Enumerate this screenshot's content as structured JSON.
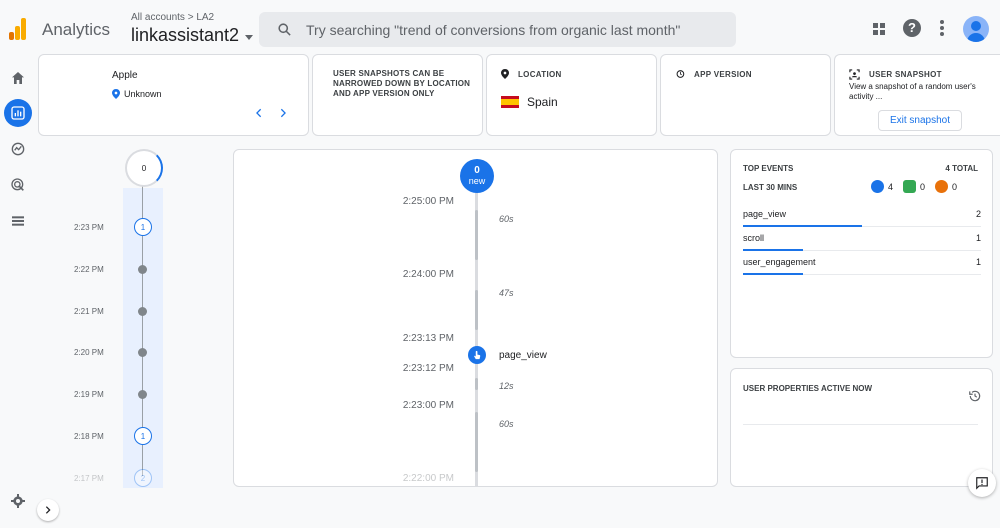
{
  "header": {
    "app_name": "Analytics",
    "account_breadcrumb": "All accounts > LA2",
    "property_name": "linkassistant2",
    "search_placeholder": "Try searching \"trend of conversions from organic last month\""
  },
  "device_card": {
    "device": "Apple",
    "location": "Unknown",
    "prev_icon": "chevron-left-icon",
    "next_icon": "chevron-right-icon"
  },
  "note_card": {
    "text": "USER SNAPSHOTS CAN BE NARROWED DOWN BY LOCATION AND APP VERSION ONLY"
  },
  "location_card": {
    "label": "LOCATION",
    "value": "Spain"
  },
  "app_version_card": {
    "label": "APP VERSION"
  },
  "snapshot_card": {
    "label": "USER SNAPSHOT",
    "description": "View a snapshot of a random user's activity ...",
    "exit_label": "Exit snapshot"
  },
  "minute_timeline": {
    "top_count": "0",
    "items": [
      {
        "time": "2:23 PM",
        "count": "1"
      },
      {
        "time": "2:22 PM",
        "count": ""
      },
      {
        "time": "2:21 PM",
        "count": ""
      },
      {
        "time": "2:20 PM",
        "count": ""
      },
      {
        "time": "2:19 PM",
        "count": ""
      },
      {
        "time": "2:18 PM",
        "count": "1"
      },
      {
        "time": "2:17 PM",
        "count": "2"
      }
    ]
  },
  "event_stream": {
    "new_count": "0",
    "new_label": "new",
    "times": [
      "2:25:00 PM",
      "2:24:00 PM",
      "2:23:13 PM",
      "2:23:12 PM",
      "2:23:00 PM",
      "2:22:00 PM"
    ],
    "durations": [
      "60s",
      "47s",
      "12s",
      "60s"
    ],
    "event_name": "page_view"
  },
  "top_events": {
    "title": "TOP EVENTS",
    "total": "4 TOTAL",
    "subtitle": "LAST 30 MINS",
    "badge_counts": {
      "events": "4",
      "conversions": "0",
      "errors": "0"
    },
    "rows": [
      {
        "name": "page_view",
        "count": "2",
        "share": 0.5
      },
      {
        "name": "scroll",
        "count": "1",
        "share": 0.25
      },
      {
        "name": "user_engagement",
        "count": "1",
        "share": 0.25
      }
    ]
  },
  "user_properties": {
    "title": "USER PROPERTIES ACTIVE NOW"
  },
  "colors": {
    "accent": "#1a73e8",
    "conversion": "#34a853",
    "error": "#e8710a"
  }
}
